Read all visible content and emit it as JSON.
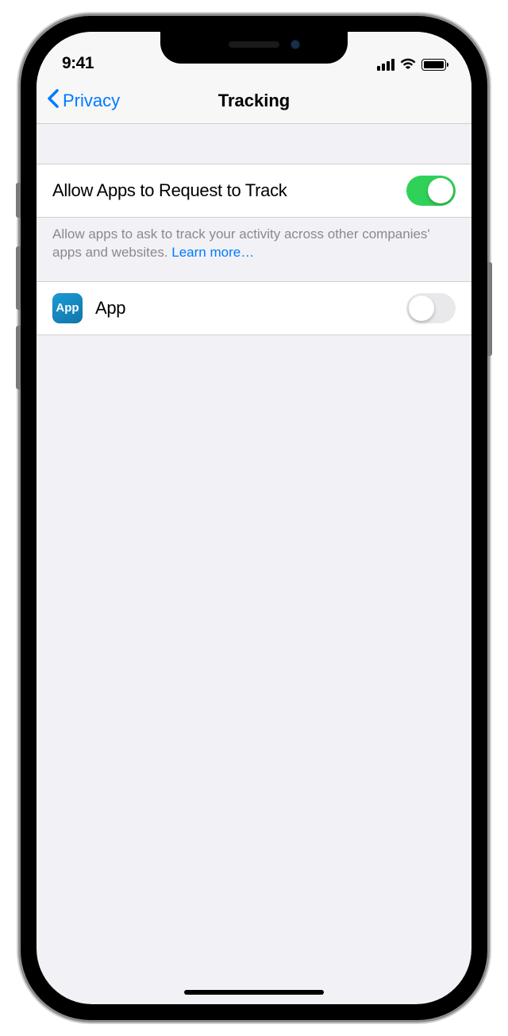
{
  "status": {
    "time": "9:41"
  },
  "nav": {
    "back_label": "Privacy",
    "title": "Tracking"
  },
  "settings": {
    "allow_tracking": {
      "label": "Allow Apps to Request to Track",
      "enabled": true
    },
    "footer_text": "Allow apps to ask to track your activity across other companies' apps and websites. ",
    "footer_link": "Learn more…"
  },
  "apps": [
    {
      "icon_label": "App",
      "name": "App",
      "tracking_enabled": false
    }
  ]
}
